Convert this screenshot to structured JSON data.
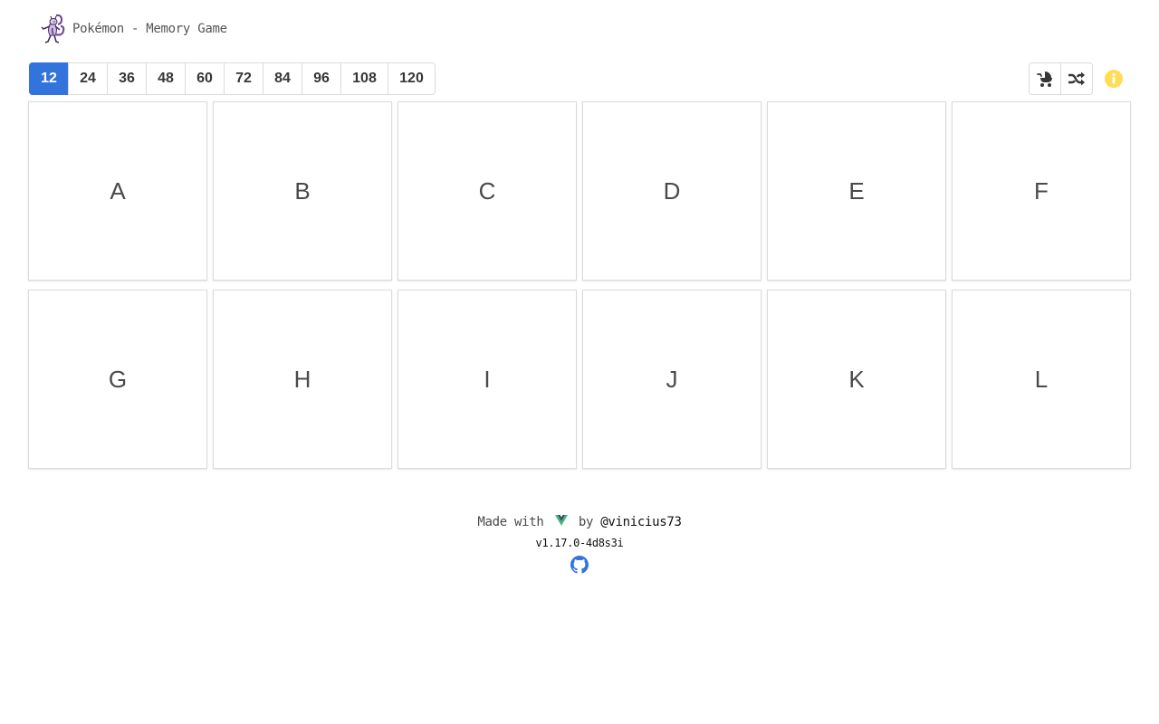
{
  "header": {
    "title": "Pokémon - Memory Game"
  },
  "sizes": {
    "options": [
      "12",
      "24",
      "36",
      "48",
      "60",
      "72",
      "84",
      "96",
      "108",
      "120"
    ],
    "selected": "12"
  },
  "tools": {
    "easy_icon": "baby-carriage-icon",
    "shuffle_icon": "shuffle-icon",
    "info_icon": "info-circle-icon"
  },
  "board": {
    "cards": [
      "A",
      "B",
      "C",
      "D",
      "E",
      "F",
      "G",
      "H",
      "I",
      "J",
      "K",
      "L"
    ]
  },
  "footer": {
    "made_with": "Made with",
    "by": "by",
    "author": "@vinicius73",
    "version": "v1.17.0-4d8s3i",
    "github_icon": "github-icon"
  },
  "colors": {
    "primary": "#3273dc",
    "info": "#ffdd57",
    "vue_green": "#41b883",
    "vue_dark": "#34495e"
  }
}
